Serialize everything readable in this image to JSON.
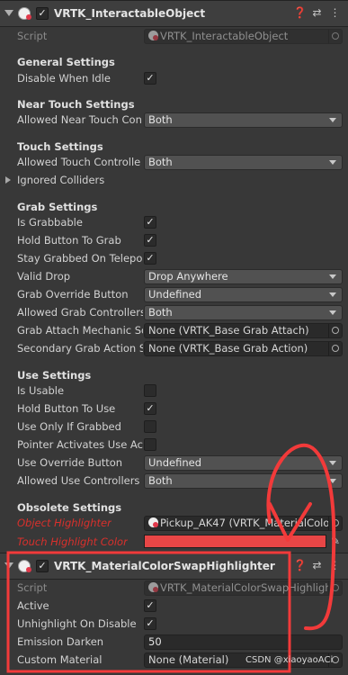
{
  "c1": {
    "title": "VRTK_InteractableObject",
    "script_label": "Script",
    "script_value": "VRTK_InteractableObject",
    "general": {
      "title": "General Settings",
      "disable_when_idle": "Disable When Idle"
    },
    "near_touch": {
      "title": "Near Touch Settings",
      "allowed_label": "Allowed Near Touch Con",
      "allowed_value": "Both"
    },
    "touch": {
      "title": "Touch Settings",
      "allowed_label": "Allowed Touch Controlle",
      "allowed_value": "Both",
      "ignored_colliders": "Ignored Colliders"
    },
    "grab": {
      "title": "Grab Settings",
      "is_grabbable": "Is Grabbable",
      "hold_button": "Hold Button To Grab",
      "stay_grabbed": "Stay Grabbed On Telepo",
      "valid_drop_label": "Valid Drop",
      "valid_drop_value": "Drop Anywhere",
      "override_label": "Grab Override Button",
      "override_value": "Undefined",
      "allowed_label": "Allowed Grab Controllers",
      "allowed_value": "Both",
      "attach_label": "Grab Attach Mechanic Sc",
      "attach_value": "None (VRTK_Base Grab Attach)",
      "secondary_label": "Secondary Grab Action S",
      "secondary_value": "None (VRTK_Base Grab Action)"
    },
    "use": {
      "title": "Use Settings",
      "is_usable": "Is Usable",
      "hold_button": "Hold Button To Use",
      "only_if_grabbed": "Use Only If Grabbed",
      "pointer_activates": "Pointer Activates Use Ac",
      "override_label": "Use Override Button",
      "override_value": "Undefined",
      "allowed_label": "Allowed Use Controllers",
      "allowed_value": "Both"
    },
    "obsolete": {
      "title": "Obsolete Settings",
      "highlighter_label": "Object Highlighter",
      "highlighter_value": "Pickup_AK47 (VRTK_MaterialColo",
      "touch_color_label": "Touch Highlight Color"
    }
  },
  "c2": {
    "title": "VRTK_MaterialColorSwapHighlighter",
    "script_label": "Script",
    "script_value": "VRTK_MaterialColorSwapHighlight",
    "active": "Active",
    "unhighlight": "Unhighlight On Disable",
    "emission_label": "Emission Darken",
    "emission_value": "50",
    "material_label": "Custom Material",
    "material_value": "None (Material)"
  },
  "checkbox_glyph": "✓",
  "icons": [
    "foldout-arrow-icon",
    "component-icon",
    "help-icon",
    "preset-icon",
    "menu-icon",
    "object-picker-icon",
    "eyedropper-icon"
  ],
  "colors": {
    "touch_highlight": "#e84646",
    "annotation": "#f23a3a"
  },
  "watermark": "CSDN @xiaoyaoACi"
}
